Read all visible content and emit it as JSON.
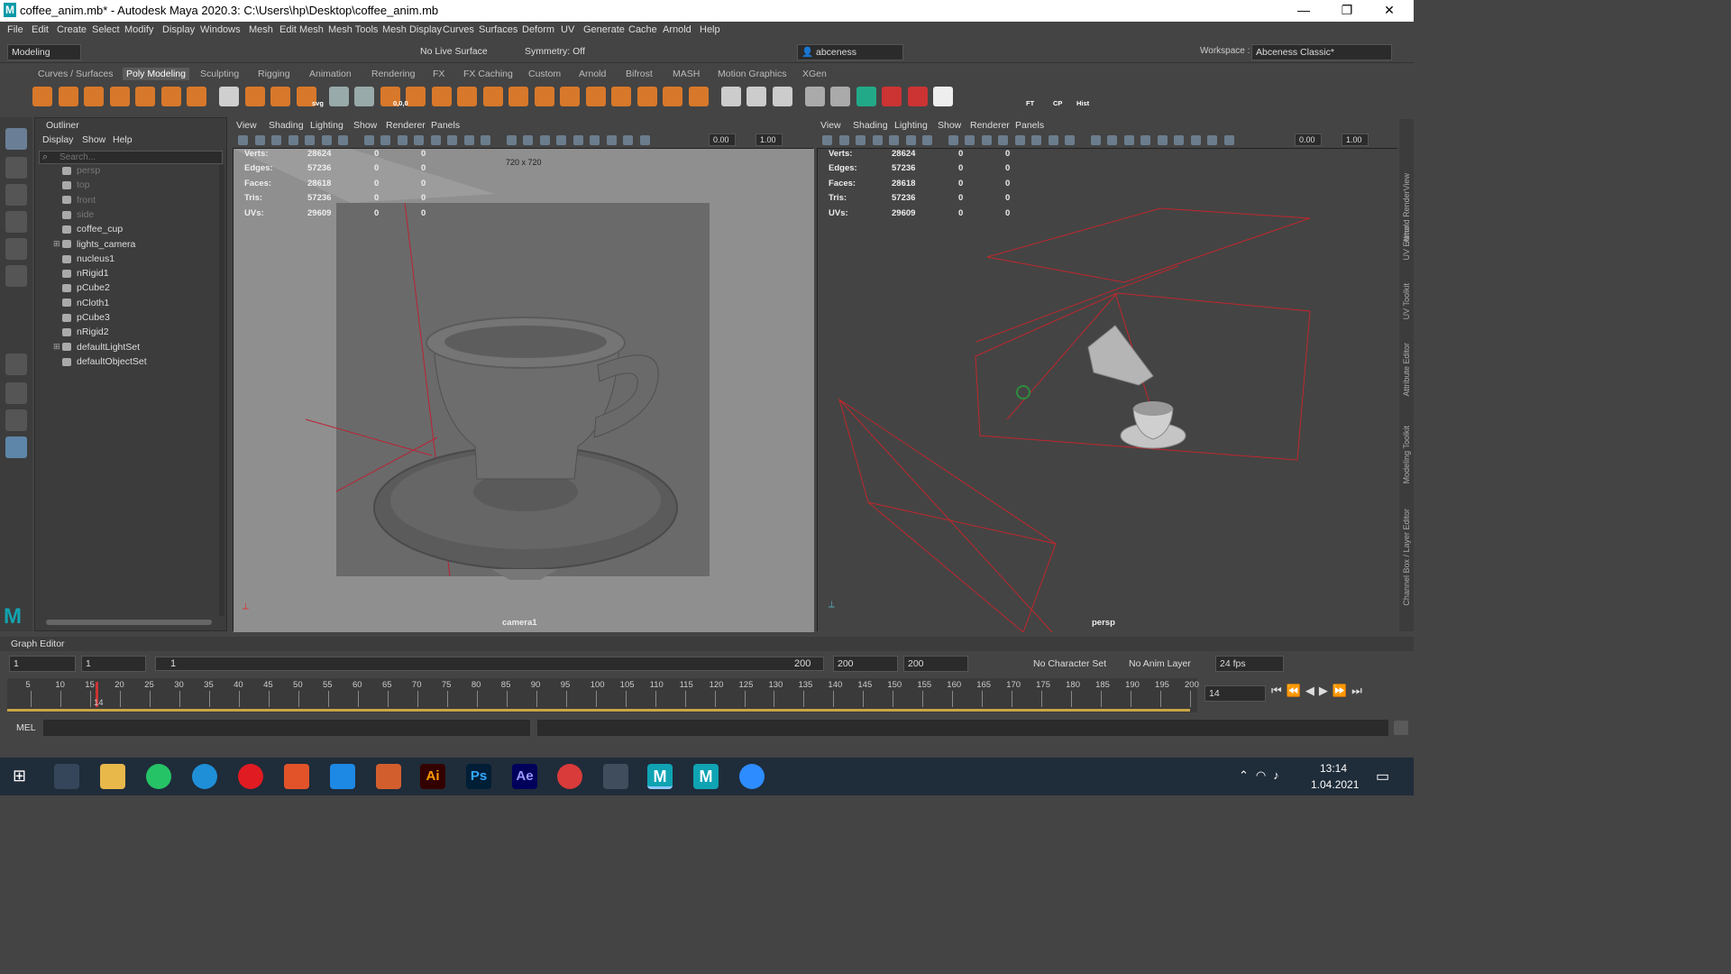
{
  "window": {
    "title": "coffee_anim.mb* - Autodesk Maya 2020.3: C:\\Users\\hp\\Desktop\\coffee_anim.mb",
    "logo": "M"
  },
  "menu": [
    "File",
    "Edit",
    "Create",
    "Select",
    "Modify",
    "Display",
    "Windows",
    "Mesh",
    "Edit Mesh",
    "Mesh Tools",
    "Mesh Display",
    "Curves",
    "Surfaces",
    "Deform",
    "UV",
    "Generate",
    "Cache",
    "Arnold",
    "Help"
  ],
  "workspace": {
    "label": "Workspace :",
    "value": "Abceness Classic*"
  },
  "statusline": {
    "mode": "Modeling",
    "live_surface": "No Live Surface",
    "symmetry": "Symmetry: Off",
    "user": "abceness"
  },
  "shelf_tabs": [
    "Curves / Surfaces",
    "Poly Modeling",
    "Sculpting",
    "Rigging",
    "Animation",
    "Rendering",
    "FX",
    "FX Caching",
    "Custom",
    "Arnold",
    "Bifrost",
    "MASH",
    "Motion Graphics",
    "XGen"
  ],
  "shelf_labels": {
    "svg": "svg",
    "zero": "0,0,0",
    "ft": "FT",
    "cp": "CP",
    "hist": "Hist"
  },
  "outliner": {
    "title": "Outliner",
    "menus": [
      "Display",
      "Show",
      "Help"
    ],
    "search_placeholder": "Search...",
    "items": [
      {
        "label": "persp",
        "dim": true
      },
      {
        "label": "top",
        "dim": true
      },
      {
        "label": "front",
        "dim": true
      },
      {
        "label": "side",
        "dim": true
      },
      {
        "label": "coffee_cup"
      },
      {
        "label": "lights_camera"
      },
      {
        "label": "nucleus1"
      },
      {
        "label": "nRigid1"
      },
      {
        "label": "pCube2"
      },
      {
        "label": "nCloth1"
      },
      {
        "label": "pCube3"
      },
      {
        "label": "nRigid2"
      },
      {
        "label": "defaultLightSet"
      },
      {
        "label": "defaultObjectSet"
      }
    ]
  },
  "viewport_menu": [
    "View",
    "Shading",
    "Lighting",
    "Show",
    "Renderer",
    "Panels"
  ],
  "vp_fields": {
    "a": "0.00",
    "b": "1.00"
  },
  "hud": [
    {
      "label": "Verts:",
      "v": "28624",
      "s1": "0",
      "s2": "0"
    },
    {
      "label": "Edges:",
      "v": "57236",
      "s1": "0",
      "s2": "0"
    },
    {
      "label": "Faces:",
      "v": "28618",
      "s1": "0",
      "s2": "0"
    },
    {
      "label": "Tris:",
      "v": "57236",
      "s1": "0",
      "s2": "0"
    },
    {
      "label": "UVs:",
      "v": "29609",
      "s1": "0",
      "s2": "0"
    }
  ],
  "left_vp": {
    "resolution": "720 x 720",
    "camera": "camera1"
  },
  "right_vp": {
    "camera": "persp"
  },
  "side_tabs": [
    "Arnold RenderView",
    "UV Editor",
    "UV Toolkit",
    "Attribute Editor",
    "Modeling Toolkit",
    "Channel Box / Layer Editor"
  ],
  "graph_editor": "Graph Editor",
  "range": {
    "start": "1",
    "anim_start": "1",
    "slider_start": "1",
    "slider_end": "200",
    "anim_end": "200",
    "end": "200",
    "char_set": "No Character Set",
    "anim_layer": "No Anim Layer",
    "fps": "24 fps"
  },
  "timeline": {
    "ticks": [
      "5",
      "10",
      "15",
      "20",
      "25",
      "30",
      "35",
      "40",
      "45",
      "50",
      "55",
      "60",
      "65",
      "70",
      "75",
      "80",
      "85",
      "90",
      "95",
      "100",
      "105",
      "110",
      "115",
      "120",
      "125",
      "130",
      "135",
      "140",
      "145",
      "150",
      "155",
      "160",
      "165",
      "170",
      "175",
      "180",
      "185",
      "190",
      "195",
      "200"
    ],
    "current": "14",
    "current_field": "14"
  },
  "mel": {
    "label": "MEL"
  },
  "taskbar": {
    "time": "13:14",
    "date": "1.04.2021"
  }
}
